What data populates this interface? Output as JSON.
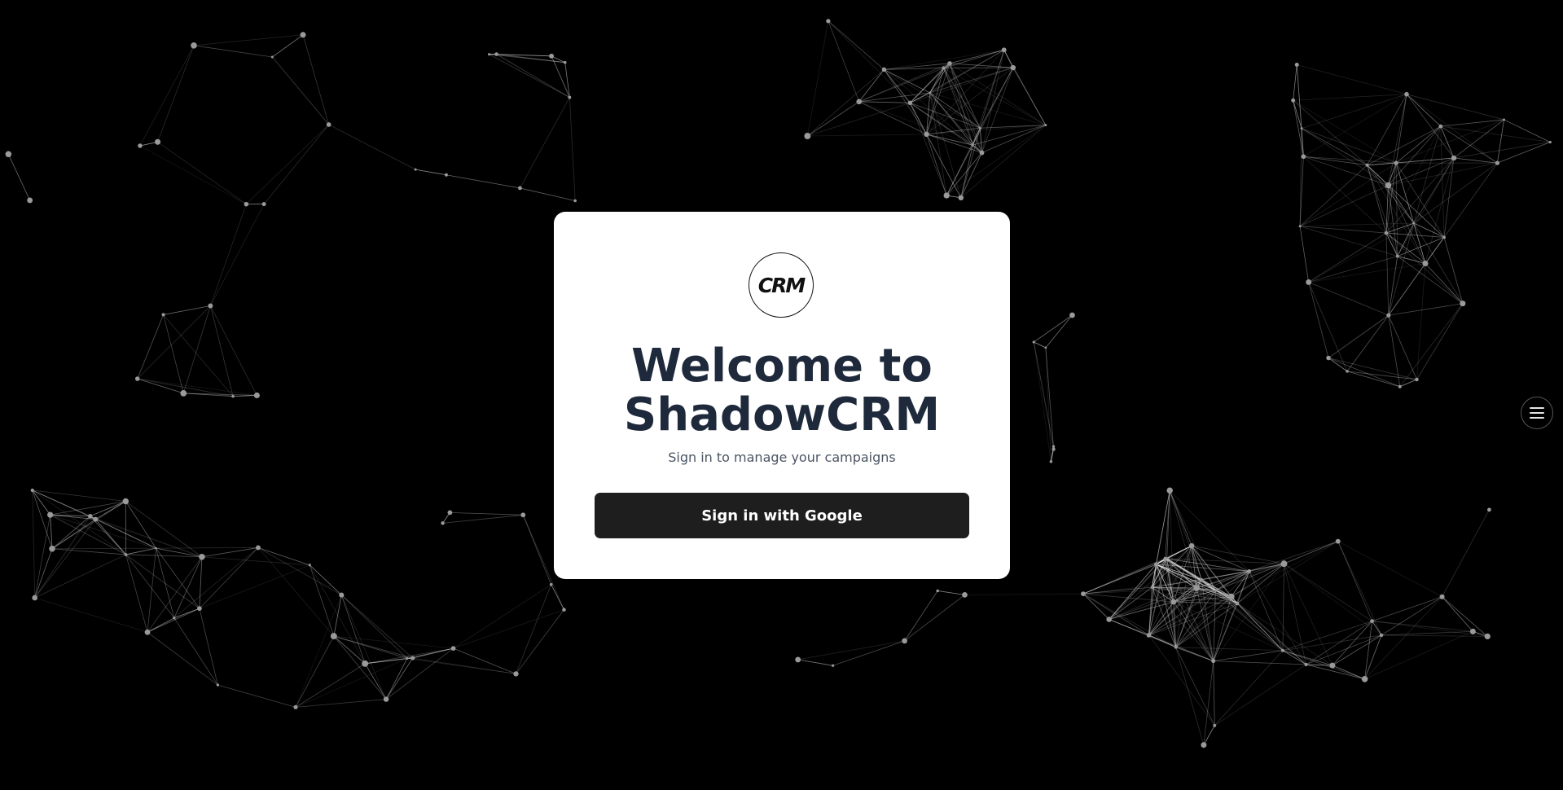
{
  "login": {
    "logo_text": "CRM",
    "title_line1": "Welcome to",
    "title_line2": "ShadowCRM",
    "subtitle": "Sign in to manage your campaigns",
    "google_button_label": "Sign in with Google"
  },
  "menu": {
    "icon": "hamburger-menu-icon"
  },
  "colors": {
    "background": "#000000",
    "card": "#ffffff",
    "title": "#1e293b",
    "subtitle": "#4b5563",
    "button": "#1e1e1e",
    "network_lines": "#ffffff",
    "network_nodes": "#9a9a9a"
  }
}
